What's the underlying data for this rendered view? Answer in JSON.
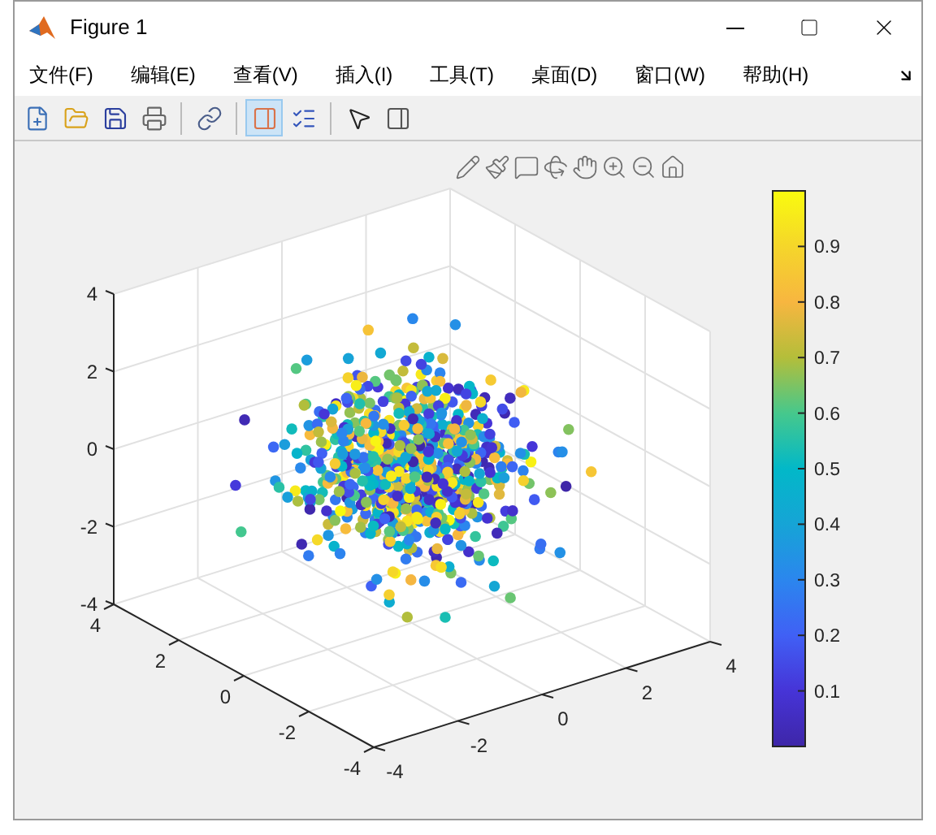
{
  "window": {
    "title": "Figure 1"
  },
  "menu": [
    "文件(F)",
    "编辑(E)",
    "查看(V)",
    "插入(I)",
    "工具(T)",
    "桌面(D)",
    "窗口(W)",
    "帮助(H)"
  ],
  "toolbar": [
    {
      "kind": "new",
      "selected": false
    },
    {
      "kind": "open",
      "selected": false
    },
    {
      "kind": "save",
      "selected": false
    },
    {
      "kind": "print",
      "selected": false
    },
    {
      "kind": "link",
      "selected": false
    },
    {
      "kind": "colorbar",
      "selected": true
    },
    {
      "kind": "legend",
      "selected": false
    },
    {
      "kind": "pointer",
      "selected": false
    },
    {
      "kind": "inspector",
      "selected": false
    }
  ],
  "plot": {
    "z_ticks": [
      "4",
      "2",
      "0",
      "-2",
      "-4"
    ],
    "y_ticks": [
      "4",
      "2",
      "0",
      "-2",
      "-4"
    ],
    "x_ticks": [
      "-4",
      "-2",
      "0",
      "2",
      "4"
    ]
  },
  "colorbar": {
    "ticks": [
      "0.9",
      "0.8",
      "0.7",
      "0.6",
      "0.5",
      "0.4",
      "0.3",
      "0.2",
      "0.1"
    ]
  }
}
